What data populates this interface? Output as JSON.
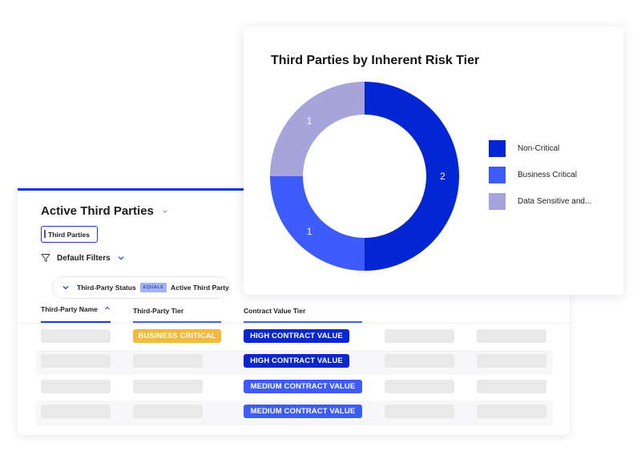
{
  "table_card": {
    "title": "Active Third Parties",
    "tab_label": "Third Parties",
    "filters_label": "Default Filters",
    "filter_chip": {
      "field": "Third-Party Status",
      "operator": "EQUALS",
      "value": "Active Third Party"
    },
    "columns": [
      {
        "label": "Third-Party Name",
        "sorted": "ascending"
      },
      {
        "label": "Third-Party Tier"
      },
      {
        "label": "Contract Value Tier"
      }
    ],
    "rows": [
      {
        "tier": "BUSINESS CRITICAL",
        "contract": "HIGH CONTRACT VALUE"
      },
      {
        "tier": null,
        "contract": "HIGH CONTRACT VALUE"
      },
      {
        "tier": null,
        "contract": "MEDIUM CONTRACT VALUE"
      },
      {
        "tier": null,
        "contract": "MEDIUM CONTRACT VALUE"
      }
    ]
  },
  "colors": {
    "accent": "#1237d6",
    "business_critical_badge": "#f4b740",
    "high_contract_badge": "#0a27cf",
    "medium_contract_badge": "#3d5cfb",
    "skeleton": "#e9e9e9"
  },
  "chart_data": {
    "type": "pie",
    "variant": "donut",
    "title": "Third Parties by Inherent Risk Tier",
    "legend_position": "right",
    "series": [
      {
        "name": "Non-Critical",
        "value": 2,
        "color": "#0326d4"
      },
      {
        "name": "Business Critical",
        "value": 1,
        "color": "#3d5cfb"
      },
      {
        "name": "Data Sensitive and...",
        "value": 1,
        "color": "#a5a5dc"
      }
    ]
  }
}
